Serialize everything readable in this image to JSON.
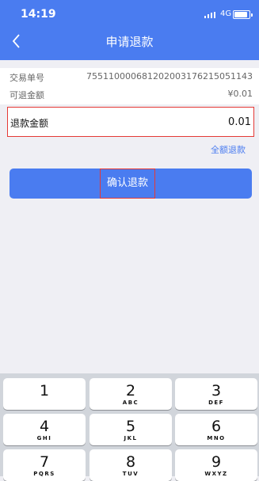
{
  "status": {
    "time": "14:19",
    "network": "4G"
  },
  "nav": {
    "back_label": "‹",
    "title": "申请退款"
  },
  "info": {
    "order_label": "交易单号",
    "order_value": "755110000681202003176215051143",
    "refundable_label": "可退金额",
    "refundable_value": "¥0.01"
  },
  "amount": {
    "label": "退款金额",
    "value": "0.01"
  },
  "full_refund_label": "全额退款",
  "confirm_label": "确认退款",
  "keyboard": {
    "keys": [
      {
        "num": "1",
        "letters": ""
      },
      {
        "num": "2",
        "letters": "ABC"
      },
      {
        "num": "3",
        "letters": "DEF"
      },
      {
        "num": "4",
        "letters": "GHI"
      },
      {
        "num": "5",
        "letters": "JKL"
      },
      {
        "num": "6",
        "letters": "MNO"
      },
      {
        "num": "7",
        "letters": "PQRS"
      },
      {
        "num": "8",
        "letters": "TUV"
      },
      {
        "num": "9",
        "letters": "WXYZ"
      }
    ]
  }
}
